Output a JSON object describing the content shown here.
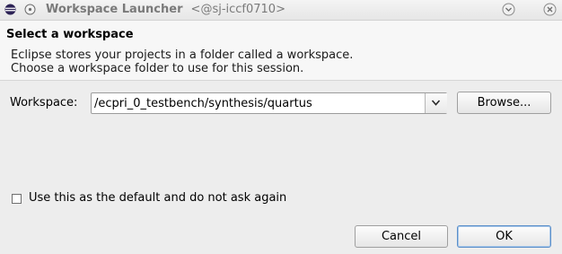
{
  "window": {
    "title": "Workspace Launcher",
    "host": "<@sj-iccf0710>"
  },
  "header": {
    "title": "Select a workspace",
    "description_line1": "Eclipse stores your projects in a folder called a workspace.",
    "description_line2": "Choose a workspace folder to use for this session."
  },
  "workspace": {
    "label": "Workspace:",
    "value": "/ecpri_0_testbench/synthesis/quartus",
    "browse_label": "Browse..."
  },
  "default_option": {
    "label": "Use this as the default and do not ask again",
    "checked": false
  },
  "buttons": {
    "cancel": "Cancel",
    "ok": "OK"
  },
  "colors": {
    "background": "#ededed",
    "header_background": "#f7f7f7",
    "ok_border": "#5b8fc9"
  },
  "icons": {
    "app": "eclipse-icon",
    "window_menu": "window-menu-icon",
    "minimize": "minimize-icon",
    "close": "close-icon",
    "dropdown": "chevron-down-icon"
  }
}
